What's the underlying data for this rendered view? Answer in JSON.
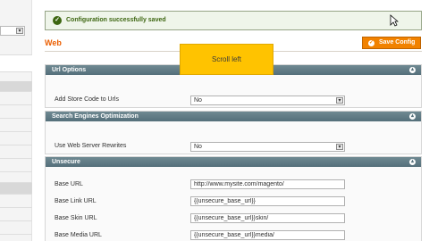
{
  "message": {
    "text": "Configuration successfully saved",
    "icon": "check-circle-icon"
  },
  "page": {
    "title": "Web",
    "save_label": "Save Config"
  },
  "tooltip": {
    "text": "Scroll left"
  },
  "sections": {
    "url_options": {
      "title": "Url Options",
      "rows": [
        {
          "label": "Add Store Code to Urls",
          "value": "No"
        }
      ]
    },
    "seo": {
      "title": "Search Engines Optimization",
      "rows": [
        {
          "label": "Use Web Server Rewrites",
          "value": "No"
        }
      ]
    },
    "unsecure": {
      "title": "Unsecure",
      "rows": [
        {
          "label": "Base URL",
          "value": "http://www.mysite.com/magento/"
        },
        {
          "label": "Base Link URL",
          "value": "{{unsecure_base_url}}"
        },
        {
          "label": "Base Skin URL",
          "value": "{{unsecure_base_url}}skin/"
        },
        {
          "label": "Base Media URL",
          "value": "{{unsecure_base_url}}media/"
        }
      ]
    }
  },
  "colors": {
    "accent": "#eb5e00",
    "button": "#f18200",
    "success": "#3d6611",
    "section_header": "#546f7a",
    "tooltip": "#ffc300"
  }
}
